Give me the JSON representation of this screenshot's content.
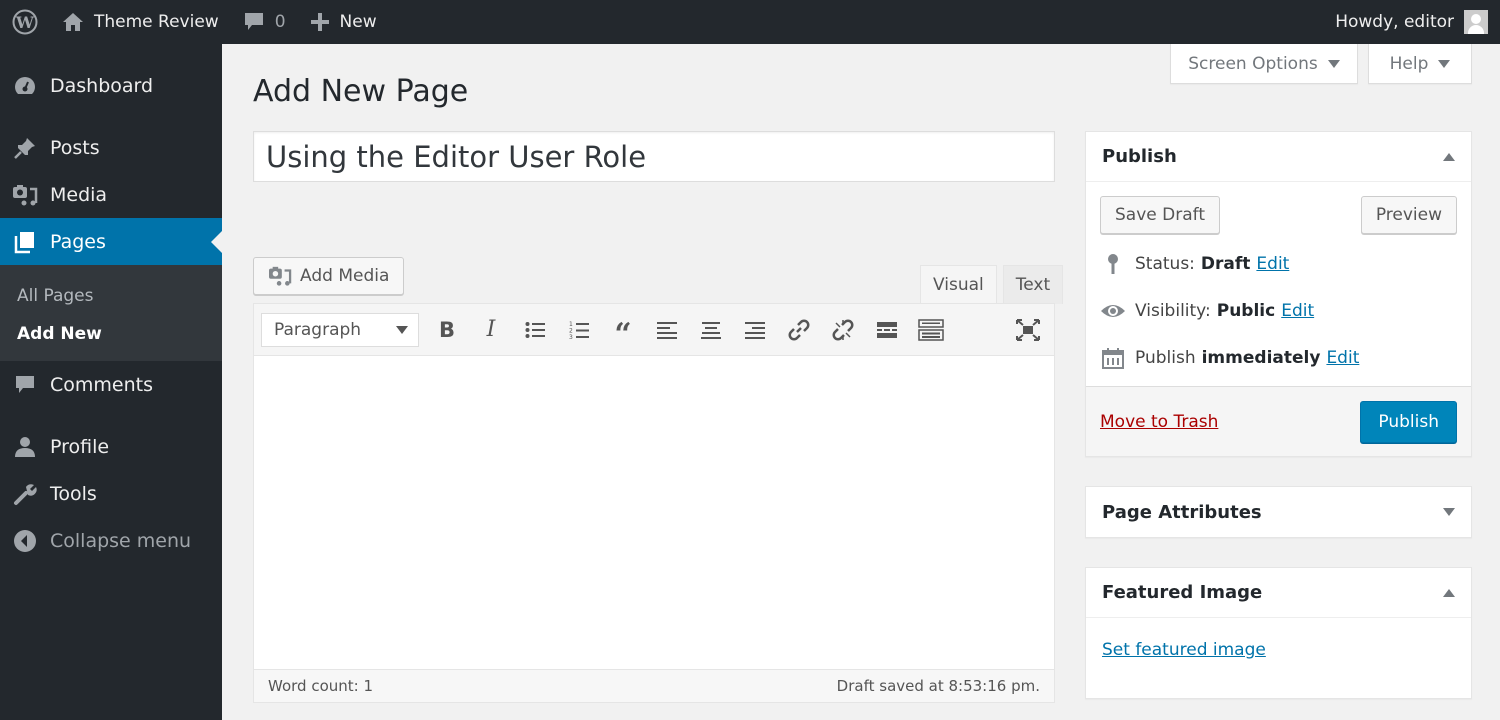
{
  "admin_bar": {
    "logo_icon": "wordpress-logo-icon",
    "site_name": "Theme Review",
    "site_icon": "home-icon",
    "comments_icon": "comment-icon",
    "comments_count": "0",
    "new_icon": "plus-icon",
    "new_label": "New",
    "greeting": "Howdy, editor",
    "avatar_icon": "user-avatar-icon"
  },
  "sidebar": {
    "items": [
      {
        "label": "Dashboard",
        "icon": "dashboard-icon"
      },
      {
        "label": "Posts",
        "icon": "pushpin-icon"
      },
      {
        "label": "Media",
        "icon": "media-icon"
      },
      {
        "label": "Pages",
        "icon": "pages-icon",
        "current": true
      },
      {
        "label": "Comments",
        "icon": "comment-icon"
      },
      {
        "label": "Profile",
        "icon": "user-icon"
      },
      {
        "label": "Tools",
        "icon": "wrench-icon"
      }
    ],
    "submenu": [
      {
        "label": "All Pages"
      },
      {
        "label": "Add New",
        "current": true
      }
    ],
    "collapse_label": "Collapse menu"
  },
  "screen_meta": {
    "screen_options_label": "Screen Options",
    "help_label": "Help"
  },
  "page": {
    "heading": "Add New Page",
    "title_value": "Using the Editor User Role"
  },
  "editor": {
    "add_media_label": "Add Media",
    "tabs": [
      {
        "label": "Visual",
        "active": true
      },
      {
        "label": "Text",
        "active": false
      }
    ],
    "format_select_value": "Paragraph",
    "toolbar_buttons": [
      "bold",
      "italic",
      "bulleted-list",
      "numbered-list",
      "blockquote",
      "align-left",
      "align-center",
      "align-right",
      "insert-link",
      "remove-link",
      "read-more",
      "toolbar-toggle",
      "fullscreen"
    ],
    "word_count": "Word count: 1",
    "draft_saved": "Draft saved at 8:53:16 pm."
  },
  "publish_box": {
    "title": "Publish",
    "save_draft_label": "Save Draft",
    "preview_label": "Preview",
    "status_label": "Status:",
    "status_value": "Draft",
    "visibility_label": "Visibility:",
    "visibility_value": "Public",
    "publish_label": "Publish",
    "publish_value": "immediately",
    "edit_label": "Edit",
    "trash_label": "Move to Trash",
    "publish_button_label": "Publish"
  },
  "attributes_box": {
    "title": "Page Attributes"
  },
  "featured_box": {
    "title": "Featured Image",
    "set_link_label": "Set featured image"
  },
  "colors": {
    "admin_bar_bg": "#23282d",
    "sidebar_current_bg": "#0073aa",
    "primary_button": "#0085ba",
    "link": "#0073aa",
    "trash_link": "#aa0000",
    "page_bg": "#f1f1f1"
  }
}
